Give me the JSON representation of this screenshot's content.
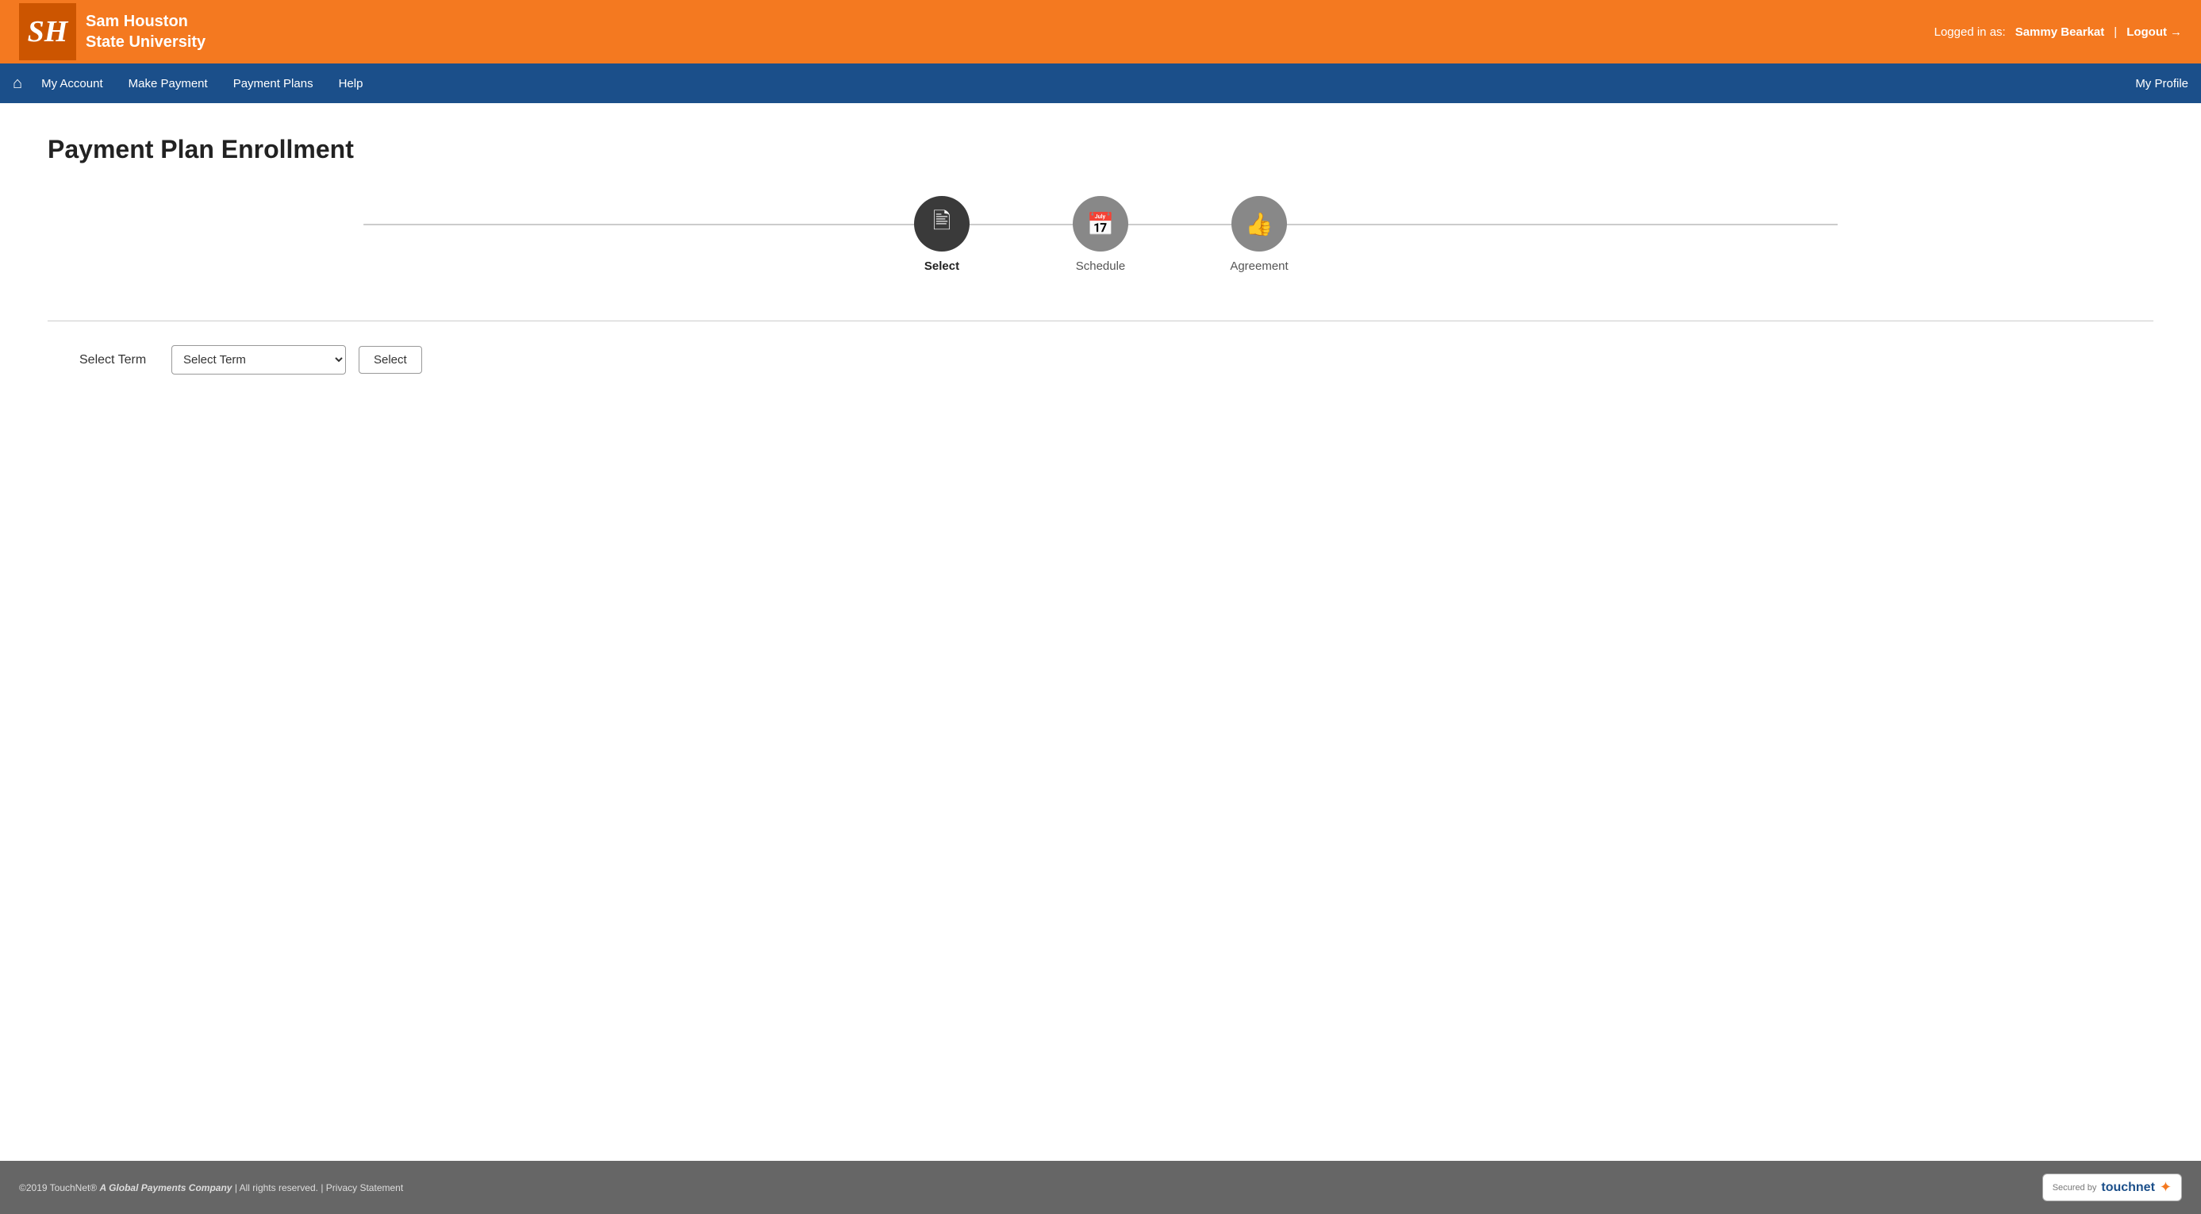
{
  "header": {
    "university_name_line1": "Sam Houston",
    "university_name_line2": "State University",
    "logo_initials": "SH",
    "logged_in_label": "Logged in as:",
    "username": "Sammy Bearkat",
    "divider": "|",
    "logout_label": "Logout"
  },
  "nav": {
    "home_icon": "⌂",
    "links": [
      {
        "label": "My Account",
        "name": "my-account"
      },
      {
        "label": "Make Payment",
        "name": "make-payment"
      },
      {
        "label": "Payment Plans",
        "name": "payment-plans"
      },
      {
        "label": "Help",
        "name": "help"
      }
    ],
    "profile_label": "My Profile"
  },
  "main": {
    "page_title": "Payment Plan Enrollment",
    "stepper": {
      "steps": [
        {
          "label": "Select",
          "icon": "📄",
          "state": "active"
        },
        {
          "label": "Schedule",
          "icon": "📅",
          "state": "inactive"
        },
        {
          "label": "Agreement",
          "icon": "👍",
          "state": "inactive"
        }
      ]
    },
    "select_term_label": "Select Term",
    "select_term_placeholder": "Select Term",
    "select_button_label": "Select"
  },
  "footer": {
    "copyright": "©2019 TouchNet",
    "reg_mark": "®",
    "company_text": "A Global Payments Company",
    "rights": "| All rights reserved.",
    "privacy": "| Privacy Statement",
    "secured_by": "Secured by",
    "touchnet_brand": "touchnet",
    "touchnet_star": "✦"
  }
}
